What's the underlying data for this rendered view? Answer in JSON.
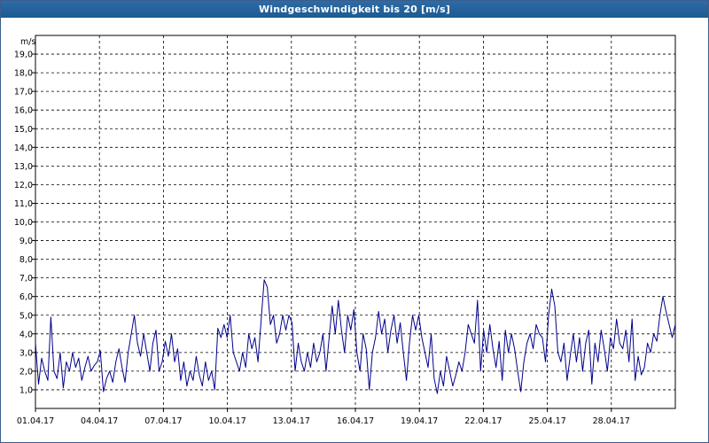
{
  "window": {
    "title": "Windgeschwindigkeit bis 20 [m/s]"
  },
  "chart_data": {
    "type": "line",
    "title": "Windgeschwindigkeit bis 20 [m/s]",
    "ylabel": "m/s",
    "xlabel": "",
    "ylim": [
      0,
      20
    ],
    "xlim": [
      "01.04.17",
      "01.05.17"
    ],
    "grid": true,
    "series_color": "#00008b",
    "y_ticks": [
      "1,0",
      "2,0",
      "3,0",
      "4,0",
      "5,0",
      "6,0",
      "7,0",
      "8,0",
      "9,0",
      "10,0",
      "11,0",
      "12,0",
      "13,0",
      "14,0",
      "15,0",
      "16,0",
      "17,0",
      "18,0",
      "19,0"
    ],
    "x_ticks": [
      "01.04.17",
      "04.04.17",
      "07.04.17",
      "10.04.17",
      "13.04.17",
      "16.04.17",
      "19.04.17",
      "22.04.17",
      "25.04.17",
      "28.04.17"
    ],
    "x": [
      "01.04.17",
      "02.04.17",
      "03.04.17",
      "04.04.17",
      "05.04.17",
      "06.04.17",
      "07.04.17",
      "08.04.17",
      "09.04.17",
      "10.04.17",
      "11.04.17",
      "12.04.17",
      "13.04.17",
      "14.04.17",
      "15.04.17",
      "16.04.17",
      "17.04.17",
      "18.04.17",
      "19.04.17",
      "20.04.17",
      "21.04.17",
      "22.04.17",
      "23.04.17",
      "24.04.17",
      "25.04.17",
      "26.04.17",
      "27.04.17",
      "28.04.17",
      "29.04.17",
      "30.04.17"
    ],
    "series": [
      {
        "values": [
          3.5,
          1.3,
          2.7,
          2.0,
          1.5,
          4.9,
          2.0,
          1.6,
          3.0,
          1.1,
          2.5,
          2.0,
          3.0,
          2.2,
          2.7,
          1.5,
          2.2,
          2.8,
          2.0,
          2.3,
          2.5,
          3.1,
          0.9,
          1.6,
          2.0,
          1.4,
          2.5,
          3.2,
          2.2,
          1.4,
          3.0,
          4.0,
          5.0,
          3.5,
          2.8,
          4.0,
          3.0,
          2.0,
          3.5,
          4.2,
          2.0,
          2.5,
          3.6,
          2.8,
          4.0,
          2.5,
          3.2,
          1.5,
          2.5,
          1.2,
          2.0,
          1.5,
          2.8,
          1.8,
          1.2,
          2.5,
          1.5,
          2.0,
          1.0,
          4.3,
          3.8,
          4.5,
          3.8,
          5.0,
          3.0,
          2.5,
          2.0,
          3.0,
          2.2,
          4.0,
          3.2,
          3.8,
          2.5,
          4.7,
          6.9,
          6.5,
          4.5,
          5.0,
          3.5,
          4.0,
          5.0,
          4.2,
          5.0,
          4.6,
          2.0,
          3.5,
          2.5,
          2.0,
          3.0,
          2.2,
          3.5,
          2.5,
          3.0,
          4.0,
          2.0,
          3.8,
          5.5,
          4.0,
          5.8,
          4.2,
          3.0,
          5.0,
          4.2,
          5.3,
          3.0,
          2.0,
          4.0,
          3.2,
          1.0,
          3.0,
          3.8,
          5.2,
          4.0,
          4.8,
          3.0,
          4.2,
          5.0,
          3.5,
          4.6,
          3.0,
          1.5,
          3.5,
          5.0,
          4.2,
          5.0,
          3.8,
          3.0,
          2.2,
          4.0,
          1.6,
          0.8,
          2.0,
          1.2,
          2.8,
          2.0,
          1.2,
          1.8,
          2.5,
          2.0,
          3.0,
          4.5,
          4.0,
          3.5,
          5.8,
          2.0,
          4.2,
          3.0,
          4.5,
          3.2,
          2.2,
          3.6,
          1.5,
          4.2,
          3.0,
          4.0,
          3.2,
          2.0,
          0.9,
          2.5,
          3.5,
          4.0,
          3.2,
          4.5,
          4.0,
          3.8,
          2.5,
          5.0,
          6.4,
          5.5,
          3.0,
          2.5,
          3.5,
          1.5,
          2.8,
          4.0,
          2.5,
          3.8,
          2.0,
          3.5,
          4.2,
          1.3,
          3.5,
          2.5,
          4.2,
          3.2,
          2.0,
          3.8,
          3.2,
          4.8,
          3.5,
          3.2,
          4.2,
          2.5,
          4.8,
          1.5,
          2.8,
          1.8,
          2.2,
          3.5,
          3.0,
          4.0,
          3.6,
          5.0,
          6.0,
          5.2,
          4.5,
          3.8,
          4.5
        ]
      }
    ]
  }
}
